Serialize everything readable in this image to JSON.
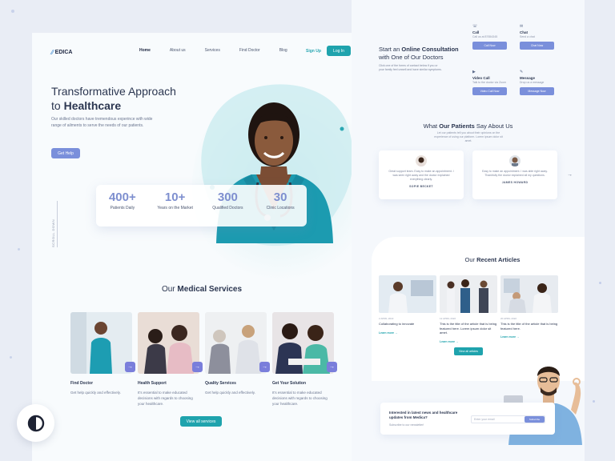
{
  "colors": {
    "accent_teal": "#1fa3ad",
    "accent_violet": "#7a8fdb",
    "text_dark": "#2b3650"
  },
  "nav": {
    "logo": "EDICA",
    "links": [
      "Home",
      "About us",
      "Services",
      "Find Doctor",
      "Blog"
    ],
    "signup": "Sign Up",
    "login": "Log In"
  },
  "hero": {
    "title_line1": "Transformative Approach",
    "title_line2_prefix": "to ",
    "title_line2_bold": "Healthcare",
    "description": "Our skilled doctors have tremendous experince with wide range of ailments to serve the needs of our patients.",
    "cta": "Get Help",
    "scroll": "SCROLL DOWN"
  },
  "stats": [
    {
      "value": "400+",
      "label": "Patients Daily"
    },
    {
      "value": "10+",
      "label": "Years on the Market"
    },
    {
      "value": "300",
      "label": "Qualified Doctors"
    },
    {
      "value": "30",
      "label": "Clinic Locations"
    }
  ],
  "services": {
    "title_prefix": "Our ",
    "title_bold": "Medical Services",
    "cards": [
      {
        "title": "Find Doctor",
        "desc": "Get help quickly and effectively."
      },
      {
        "title": "Health Support",
        "desc": "It's essential to make educated decisions with regards to choosing your healthcare."
      },
      {
        "title": "Quality Services",
        "desc": "Get help quickly and effectively."
      },
      {
        "title": "Get Your Solution",
        "desc": "It's essential to make educated decisions with regards to choosing your healthcare."
      }
    ],
    "view_all": "View all services"
  },
  "consult": {
    "title_prefix": "Start an ",
    "title_bold": "Online Consultation",
    "title_line2": "with One of Our Doctors",
    "desc": "Click one of the forms of contact below if you or your family feel unwell and have similar symptoms.",
    "options": [
      {
        "title": "Call",
        "sub": "Call us at 87654345",
        "button": "Call Now"
      },
      {
        "title": "Chat",
        "sub": "Send a chat",
        "button": "Chat Now"
      },
      {
        "title": "Video Call",
        "sub": "Talk to the doctor via Zoom",
        "button": "Video Call Now"
      },
      {
        "title": "Message",
        "sub": "Drop us a message",
        "button": "Message Now"
      }
    ]
  },
  "testimonials": {
    "title_prefix": "What ",
    "title_bold": "Our Patients",
    "title_suffix": " Say About Us",
    "sub": "Let our patients tell you about their opinions on the experience of using our platform. Lorem ipsum dolor sit amet.",
    "items": [
      {
        "quote": "Great support team. Easy to make an appointment. I was seen right away and the doctor explained everything clearly.",
        "name": "SOPIE BECKET"
      },
      {
        "quote": "Easy to make an appointment. I was able right away. Thankfully the doctor explained all my questions.",
        "name": "JAMES HOWARD"
      }
    ]
  },
  "articles": {
    "title_prefix": "Our ",
    "title_bold": "Recent Articles",
    "items": [
      {
        "date": "2 APRIL 2022",
        "title": "Collaborating to innovate",
        "link": "Learn more"
      },
      {
        "date": "12 APRIL 2022",
        "title": "This is the title of the article that is being featured here. Lorem ipsum dolor sit amet.",
        "link": "Learn more"
      },
      {
        "date": "20 APRIL 2022",
        "title": "This is the title of the article that is being featured here.",
        "link": "Learn more"
      }
    ],
    "view_all": "View all articles"
  },
  "newsletter": {
    "title": "Interested in latest news and healthcare updates from Medica?",
    "sub": "Subscribe to our newsletter!",
    "placeholder": "Enter your email",
    "button": "Subscribe"
  }
}
